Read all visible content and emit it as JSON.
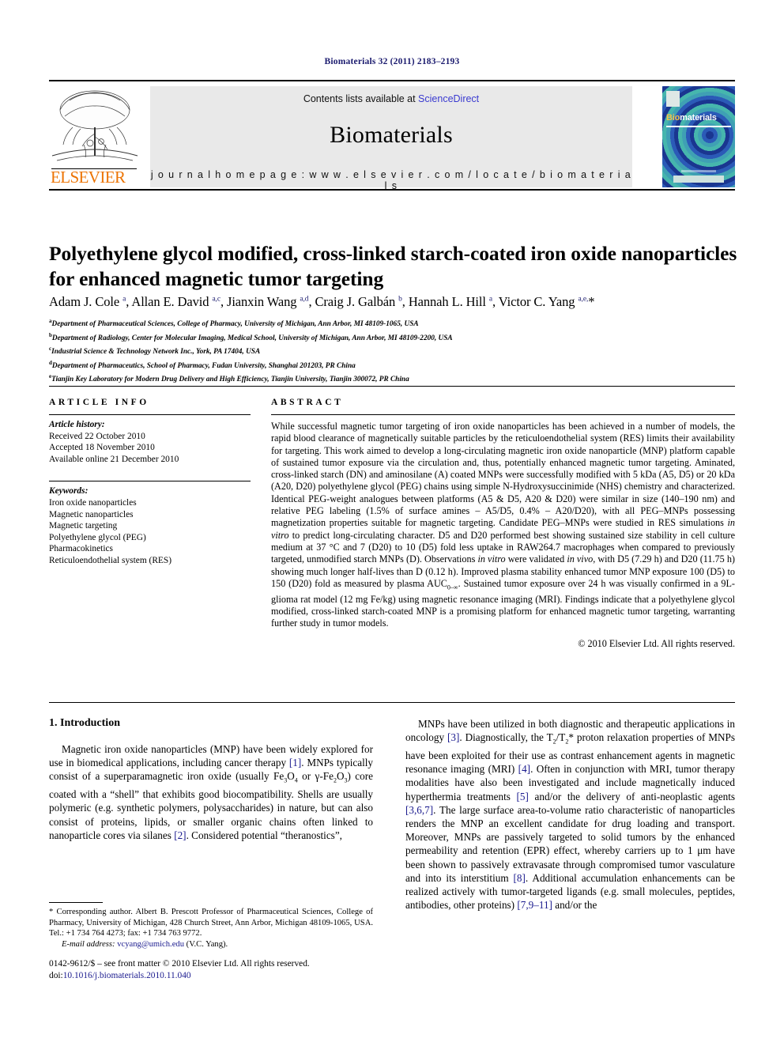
{
  "running_head": "Biomaterials 32 (2011) 2183–2193",
  "masthead": {
    "contents_text": "Contents lists available at ",
    "sciencedirect": "ScienceDirect",
    "journal_name": "Biomaterials",
    "homepage": "j o u r n a l   h o m e p a g e :   w w w . e l s e v i e r . c o m / l o c a t e / b i o m a t e r i a l s",
    "publisher_logo": "ELSEVIER",
    "cover": {
      "title_part1": "Bio",
      "title_part2": "materials"
    },
    "link_color": "#3a3ad0",
    "publisher_color": "#ec7404"
  },
  "article": {
    "title": "Polyethylene glycol modified, cross-linked starch-coated iron oxide nanoparticles for enhanced magnetic tumor targeting",
    "authors_html": "Adam J. Cole <sup>a</sup>, Allan E. David <sup>a,c</sup>, Jianxin Wang <sup>a,d</sup>, Craig J. Galbán <sup>b</sup>, Hannah L. Hill <sup>a</sup>, Victor C. Yang <sup>a,e,</sup>*",
    "affiliations": [
      {
        "marker": "a",
        "text": "Department of Pharmaceutical Sciences, College of Pharmacy, University of Michigan, Ann Arbor, MI 48109-1065, USA"
      },
      {
        "marker": "b",
        "text": "Department of Radiology, Center for Molecular Imaging, Medical School, University of Michigan, Ann Arbor, MI 48109-2200, USA"
      },
      {
        "marker": "c",
        "text": "Industrial Science & Technology Network Inc., York, PA 17404, USA"
      },
      {
        "marker": "d",
        "text": "Department of Pharmaceutics, School of Pharmacy, Fudan University, Shanghai 201203, PR China"
      },
      {
        "marker": "e",
        "text": "Tianjin Key Laboratory for Modern Drug Delivery and High Efficiency, Tianjin University, Tianjin 300072, PR China"
      }
    ]
  },
  "article_info": {
    "heading": "ARTICLE INFO",
    "history_label": "Article history:",
    "history": [
      "Received 22 October 2010",
      "Accepted 18 November 2010",
      "Available online 21 December 2010"
    ],
    "keywords_label": "Keywords:",
    "keywords": [
      "Iron oxide nanoparticles",
      "Magnetic nanoparticles",
      "Magnetic targeting",
      "Polyethylene glycol (PEG)",
      "Pharmacokinetics",
      "Reticuloendothelial system (RES)"
    ]
  },
  "abstract": {
    "heading": "ABSTRACT",
    "text_html": "While successful magnetic tumor targeting of iron oxide nanoparticles has been achieved in a number of models, the rapid blood clearance of magnetically suitable particles by the reticuloendothelial system (RES) limits their availability for targeting. This work aimed to develop a long-circulating magnetic iron oxide nanoparticle (MNP) platform capable of sustained tumor exposure via the circulation and, thus, potentially enhanced magnetic tumor targeting. Aminated, cross-linked starch (DN) and aminosilane (A) coated MNPs were successfully modified with 5 kDa (A5, D5) or 20 kDa (A20, D20) polyethylene glycol (PEG) chains using simple N-Hydroxysuccinimide (NHS) chemistry and characterized. Identical PEG-weight analogues between platforms (A5 &amp; D5, A20 &amp; D20) were similar in size (140&#8211;190 nm) and relative PEG labeling (1.5% of surface amines &#8211; A5/D5, 0.4% &#8211; A20/D20), with all PEG&#8211;MNPs possessing magnetization properties suitable for magnetic targeting. Candidate PEG&#8211;MNPs were studied in RES simulations <i>in vitro</i> to predict long-circulating character. D5 and D20 performed best showing sustained size stability in cell culture medium at 37 &#176;C and 7 (D20) to 10 (D5) fold less uptake in RAW264.7 macrophages when compared to previously targeted, unmodified starch MNPs (D). Observations <i>in vitro</i> were validated <i>in vivo</i>, with D5 (7.29 h) and D20 (11.75 h) showing much longer half-lives than D (0.12 h). Improved plasma stability enhanced tumor MNP exposure 100 (D5) to 150 (D20) fold as measured by plasma AUC<sub>0&#8211;&#8734;</sub>. Sustained tumor exposure over 24 h was visually confirmed in a 9L-glioma rat model (12 mg Fe/kg) using magnetic resonance imaging (MRI). Findings indicate that a polyethylene glycol modified, cross-linked starch-coated MNP is a promising platform for enhanced magnetic tumor targeting, warranting further study in tumor models.",
    "copyright": "© 2010 Elsevier Ltd. All rights reserved."
  },
  "introduction": {
    "heading": "1.  Introduction",
    "left_paragraph_html": "Magnetic iron oxide nanoparticles (MNP) have been widely explored for use in biomedical applications, including cancer therapy <span class=\"ref\">[1]</span>. MNPs typically consist of a superparamagnetic iron oxide (usually Fe<sub>3</sub>O<sub>4</sub> or &#947;-Fe<sub>2</sub>O<sub>3</sub>) core coated with a &#8220;shell&#8221; that exhibits good biocompatibility. Shells are usually polymeric (e.g. synthetic polymers, polysaccharides) in nature, but can also consist of proteins, lipids, or smaller organic chains often linked to nanoparticle cores via silanes <span class=\"ref\">[2]</span>. Considered potential &#8220;theranostics&#8221;,",
    "right_paragraph_html": "MNPs have been utilized in both diagnostic and therapeutic applications in oncology <span class=\"ref\">[3]</span>. Diagnostically, the T<sub>2</sub>/T<sub>2</sub>* proton relaxation properties of MNPs have been exploited for their use as contrast enhancement agents in magnetic resonance imaging (MRI) <span class=\"ref\">[4]</span>. Often in conjunction with MRI, tumor therapy modalities have also been investigated and include magnetically induced hyperthermia treatments <span class=\"ref\">[5]</span> and/or the delivery of anti-neoplastic agents <span class=\"ref\">[3,6,7]</span>. The large surface area-to-volume ratio characteristic of nanoparticles renders the MNP an excellent candidate for drug loading and transport. Moreover, MNPs are passively targeted to solid tumors by the enhanced permeability and retention (EPR) effect, whereby carriers up to 1 &#956;m have been shown to passively extravasate through compromised tumor vasculature and into its interstitium <span class=\"ref\">[8]</span>. Additional accumulation enhancements can be realized actively with tumor-targeted ligands (e.g. small molecules, peptides, antibodies, other proteins) <span class=\"ref\">[7,9&#8211;11]</span> and/or the"
  },
  "footnote": {
    "corresponding_html": "* Corresponding author. Albert B. Prescott Professor of Pharmaceutical Sciences, College of Pharmacy, University of Michigan, 428 Church Street, Ann Arbor, Michigan 48109-1065, USA. Tel.: +1 734 764 4273; fax: +1 734 763 9772.",
    "email_label": "E-mail address:",
    "email": "vcyang@umich.edu",
    "email_owner": "(V.C. Yang)."
  },
  "imprint": {
    "issn_line": "0142-9612/$ – see front matter © 2010 Elsevier Ltd. All rights reserved.",
    "doi_label": "doi:",
    "doi": "10.1016/j.biomaterials.2010.11.040"
  }
}
